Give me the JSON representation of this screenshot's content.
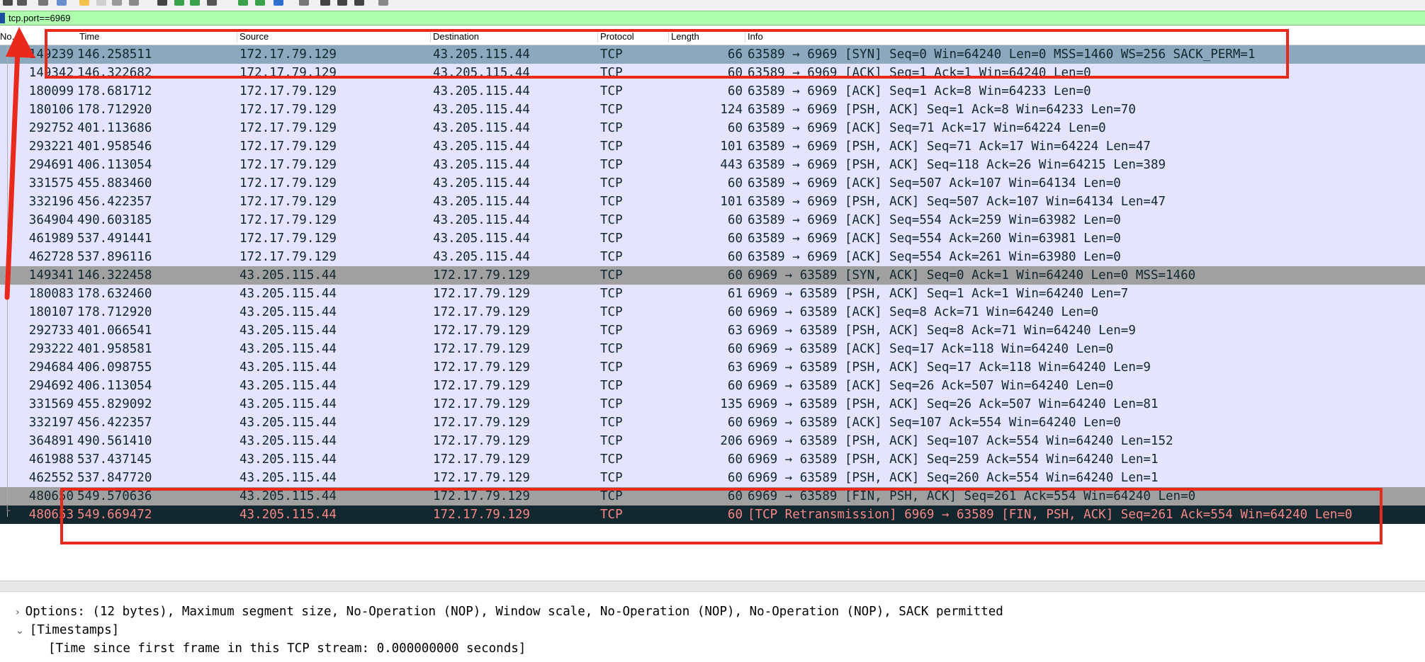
{
  "filter": {
    "value": "tcp.port==6969"
  },
  "columns": {
    "no": "No.",
    "time": "Time",
    "source": "Source",
    "destination": "Destination",
    "protocol": "Protocol",
    "length": "Length",
    "info": "Info"
  },
  "packets": [
    {
      "no": "149239",
      "time": "146.258511",
      "src": "172.17.79.129",
      "dst": "43.205.115.44",
      "proto": "TCP",
      "len": "66",
      "info": "63589 → 6969 [SYN] Seq=0 Win=64240 Len=0 MSS=1460 WS=256 SACK_PERM=1"
    },
    {
      "no": "149342",
      "time": "146.322682",
      "src": "172.17.79.129",
      "dst": "43.205.115.44",
      "proto": "TCP",
      "len": "60",
      "info": "63589 → 6969 [ACK] Seq=1 Ack=1 Win=64240 Len=0"
    },
    {
      "no": "180099",
      "time": "178.681712",
      "src": "172.17.79.129",
      "dst": "43.205.115.44",
      "proto": "TCP",
      "len": "60",
      "info": "63589 → 6969 [ACK] Seq=1 Ack=8 Win=64233 Len=0"
    },
    {
      "no": "180106",
      "time": "178.712920",
      "src": "172.17.79.129",
      "dst": "43.205.115.44",
      "proto": "TCP",
      "len": "124",
      "info": "63589 → 6969 [PSH, ACK] Seq=1 Ack=8 Win=64233 Len=70"
    },
    {
      "no": "292752",
      "time": "401.113686",
      "src": "172.17.79.129",
      "dst": "43.205.115.44",
      "proto": "TCP",
      "len": "60",
      "info": "63589 → 6969 [ACK] Seq=71 Ack=17 Win=64224 Len=0"
    },
    {
      "no": "293221",
      "time": "401.958546",
      "src": "172.17.79.129",
      "dst": "43.205.115.44",
      "proto": "TCP",
      "len": "101",
      "info": "63589 → 6969 [PSH, ACK] Seq=71 Ack=17 Win=64224 Len=47"
    },
    {
      "no": "294691",
      "time": "406.113054",
      "src": "172.17.79.129",
      "dst": "43.205.115.44",
      "proto": "TCP",
      "len": "443",
      "info": "63589 → 6969 [PSH, ACK] Seq=118 Ack=26 Win=64215 Len=389"
    },
    {
      "no": "331575",
      "time": "455.883460",
      "src": "172.17.79.129",
      "dst": "43.205.115.44",
      "proto": "TCP",
      "len": "60",
      "info": "63589 → 6969 [ACK] Seq=507 Ack=107 Win=64134 Len=0"
    },
    {
      "no": "332196",
      "time": "456.422357",
      "src": "172.17.79.129",
      "dst": "43.205.115.44",
      "proto": "TCP",
      "len": "101",
      "info": "63589 → 6969 [PSH, ACK] Seq=507 Ack=107 Win=64134 Len=47"
    },
    {
      "no": "364904",
      "time": "490.603185",
      "src": "172.17.79.129",
      "dst": "43.205.115.44",
      "proto": "TCP",
      "len": "60",
      "info": "63589 → 6969 [ACK] Seq=554 Ack=259 Win=63982 Len=0"
    },
    {
      "no": "461989",
      "time": "537.491441",
      "src": "172.17.79.129",
      "dst": "43.205.115.44",
      "proto": "TCP",
      "len": "60",
      "info": "63589 → 6969 [ACK] Seq=554 Ack=260 Win=63981 Len=0"
    },
    {
      "no": "462728",
      "time": "537.896116",
      "src": "172.17.79.129",
      "dst": "43.205.115.44",
      "proto": "TCP",
      "len": "60",
      "info": "63589 → 6969 [ACK] Seq=554 Ack=261 Win=63980 Len=0"
    },
    {
      "no": "149341",
      "time": "146.322458",
      "src": "43.205.115.44",
      "dst": "172.17.79.129",
      "proto": "TCP",
      "len": "60",
      "info": "6969 → 63589 [SYN, ACK] Seq=0 Ack=1 Win=64240 Len=0 MSS=1460"
    },
    {
      "no": "180083",
      "time": "178.632460",
      "src": "43.205.115.44",
      "dst": "172.17.79.129",
      "proto": "TCP",
      "len": "61",
      "info": "6969 → 63589 [PSH, ACK] Seq=1 Ack=1 Win=64240 Len=7"
    },
    {
      "no": "180107",
      "time": "178.712920",
      "src": "43.205.115.44",
      "dst": "172.17.79.129",
      "proto": "TCP",
      "len": "60",
      "info": "6969 → 63589 [ACK] Seq=8 Ack=71 Win=64240 Len=0"
    },
    {
      "no": "292733",
      "time": "401.066541",
      "src": "43.205.115.44",
      "dst": "172.17.79.129",
      "proto": "TCP",
      "len": "63",
      "info": "6969 → 63589 [PSH, ACK] Seq=8 Ack=71 Win=64240 Len=9"
    },
    {
      "no": "293222",
      "time": "401.958581",
      "src": "43.205.115.44",
      "dst": "172.17.79.129",
      "proto": "TCP",
      "len": "60",
      "info": "6969 → 63589 [ACK] Seq=17 Ack=118 Win=64240 Len=0"
    },
    {
      "no": "294684",
      "time": "406.098755",
      "src": "43.205.115.44",
      "dst": "172.17.79.129",
      "proto": "TCP",
      "len": "63",
      "info": "6969 → 63589 [PSH, ACK] Seq=17 Ack=118 Win=64240 Len=9"
    },
    {
      "no": "294692",
      "time": "406.113054",
      "src": "43.205.115.44",
      "dst": "172.17.79.129",
      "proto": "TCP",
      "len": "60",
      "info": "6969 → 63589 [ACK] Seq=26 Ack=507 Win=64240 Len=0"
    },
    {
      "no": "331569",
      "time": "455.829092",
      "src": "43.205.115.44",
      "dst": "172.17.79.129",
      "proto": "TCP",
      "len": "135",
      "info": "6969 → 63589 [PSH, ACK] Seq=26 Ack=507 Win=64240 Len=81"
    },
    {
      "no": "332197",
      "time": "456.422357",
      "src": "43.205.115.44",
      "dst": "172.17.79.129",
      "proto": "TCP",
      "len": "60",
      "info": "6969 → 63589 [ACK] Seq=107 Ack=554 Win=64240 Len=0"
    },
    {
      "no": "364891",
      "time": "490.561410",
      "src": "43.205.115.44",
      "dst": "172.17.79.129",
      "proto": "TCP",
      "len": "206",
      "info": "6969 → 63589 [PSH, ACK] Seq=107 Ack=554 Win=64240 Len=152"
    },
    {
      "no": "461988",
      "time": "537.437145",
      "src": "43.205.115.44",
      "dst": "172.17.79.129",
      "proto": "TCP",
      "len": "60",
      "info": "6969 → 63589 [PSH, ACK] Seq=259 Ack=554 Win=64240 Len=1"
    },
    {
      "no": "462552",
      "time": "537.847720",
      "src": "43.205.115.44",
      "dst": "172.17.79.129",
      "proto": "TCP",
      "len": "60",
      "info": "6969 → 63589 [PSH, ACK] Seq=260 Ack=554 Win=64240 Len=1"
    },
    {
      "no": "480650",
      "time": "549.570636",
      "src": "43.205.115.44",
      "dst": "172.17.79.129",
      "proto": "TCP",
      "len": "60",
      "info": "6969 → 63589 [FIN, PSH, ACK] Seq=261 Ack=554 Win=64240 Len=0"
    },
    {
      "no": "480653",
      "time": "549.669472",
      "src": "43.205.115.44",
      "dst": "172.17.79.129",
      "proto": "TCP",
      "len": "60",
      "info": "[TCP Retransmission] 6969 → 63589 [FIN, PSH, ACK] Seq=261 Ack=554 Win=64240 Len=0"
    }
  ],
  "row_styles": [
    "selected",
    "client",
    "client",
    "client",
    "client",
    "client",
    "client",
    "client",
    "client",
    "client",
    "client",
    "client",
    "flagged",
    "client",
    "client",
    "client",
    "client",
    "client",
    "client",
    "client",
    "client",
    "client",
    "client",
    "client",
    "flagged",
    "retrans"
  ],
  "details": {
    "options": "Options: (12 bytes), Maximum segment size, No-Operation (NOP), Window scale, No-Operation (NOP), No-Operation (NOP), SACK permitted",
    "timestamps": "[Timestamps]",
    "time_since_first": "[Time since first frame in this TCP stream: 0.000000000 seconds]"
  },
  "colors": {
    "filter_bg": "#afffaf",
    "client_row": "#e4e4ff",
    "selected_row": "#8ba8bf",
    "flagged_row": "#a0a0a0",
    "retrans_bg": "#12272e",
    "retrans_text": "#f78787",
    "annotation_red": "#e8291c"
  }
}
